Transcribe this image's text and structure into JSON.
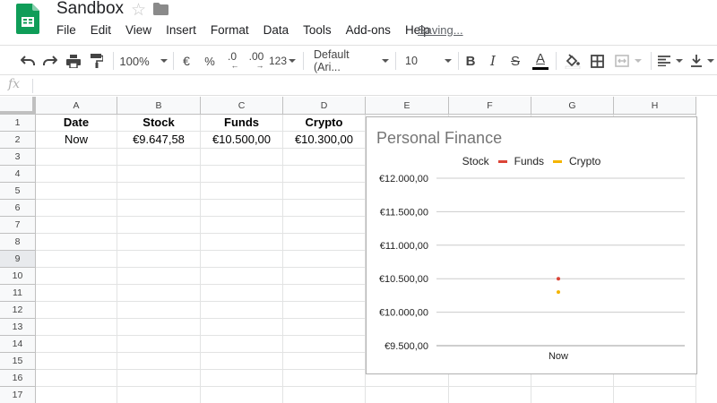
{
  "app": {
    "title": "Sandbox",
    "menu": [
      "File",
      "Edit",
      "View",
      "Insert",
      "Format",
      "Data",
      "Tools",
      "Add-ons",
      "Help"
    ],
    "status": "Saving...",
    "brand_color": "#0f9d58"
  },
  "toolbar": {
    "zoom": "100%",
    "currency": "€",
    "percent": "%",
    "decrease_decimals": ".0",
    "increase_decimals": ".00",
    "more_formats": "123",
    "font": "Default (Ari...",
    "font_size": "10",
    "bold": "B",
    "italic": "I",
    "strikethrough": "S",
    "text_color": "A"
  },
  "formula_bar": {
    "icon": "fx",
    "value": ""
  },
  "sheet": {
    "columns": [
      "A",
      "B",
      "C",
      "D",
      "E",
      "F",
      "G",
      "H"
    ],
    "rows": [
      "1",
      "2",
      "3",
      "4",
      "5",
      "6",
      "7",
      "8",
      "9",
      "10",
      "11",
      "12",
      "13",
      "14",
      "15",
      "16",
      "17"
    ],
    "selected_row": "9",
    "cells": {
      "A1": "Date",
      "B1": "Stock",
      "C1": "Funds",
      "D1": "Crypto",
      "A2": "Now",
      "B2": "€9.647,58",
      "C2": "€10.500,00",
      "D2": "€10.300,00"
    }
  },
  "chart_data": {
    "type": "line",
    "title": "Personal Finance",
    "categories": [
      "Now"
    ],
    "series": [
      {
        "name": "Stock",
        "values": [
          9647.58
        ],
        "color": "#4285f4",
        "visible": false
      },
      {
        "name": "Funds",
        "values": [
          10500
        ],
        "color": "#db4437"
      },
      {
        "name": "Crypto",
        "values": [
          10300
        ],
        "color": "#f4b400"
      }
    ],
    "y_ticks": [
      "€12.000,00",
      "€11.500,00",
      "€11.000,00",
      "€10.500,00",
      "€10.000,00",
      "€9.500,00"
    ],
    "y_tick_values": [
      12000,
      11500,
      11000,
      10500,
      10000,
      9500
    ],
    "ylim": [
      9500,
      12000
    ],
    "legend_position": "top",
    "grid": true
  }
}
